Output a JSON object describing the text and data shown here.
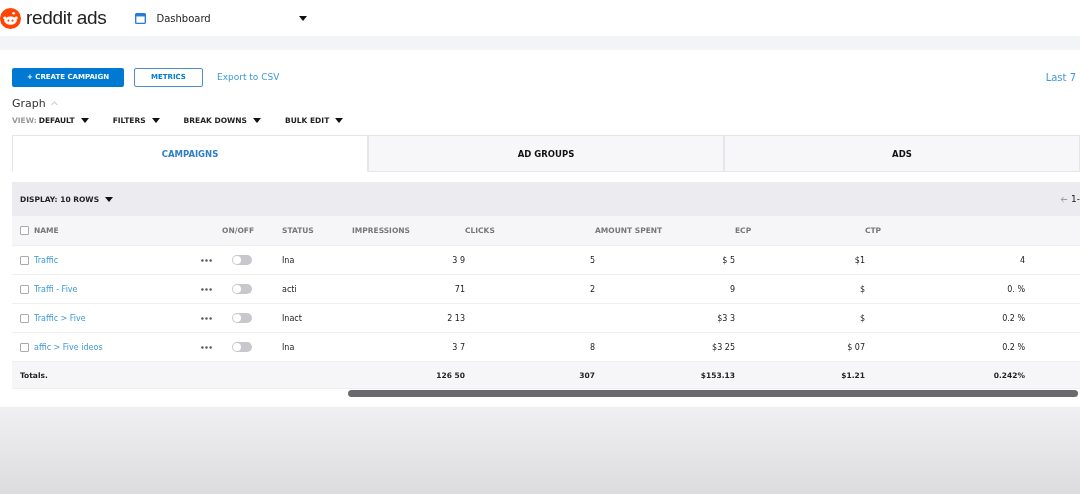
{
  "header": {
    "logo": "reddit ads",
    "page": "Dashboard"
  },
  "actions": {
    "create": "+ CREATE CAMPAIGN",
    "metrics": "METRICS",
    "export": "Export to CSV",
    "date_range": "Last 7"
  },
  "graph": {
    "title": "Graph",
    "expanded": true
  },
  "view_controls": [
    {
      "label": "VIEW:",
      "value": "DEFAULT"
    },
    {
      "label": "FILTERS"
    },
    {
      "label": "BREAK DOWNS"
    },
    {
      "label": "BULK EDIT"
    }
  ],
  "tabs": [
    {
      "label": "CAMPAIGNS",
      "selected": true
    },
    {
      "label": "AD GROUPS",
      "selected": false
    },
    {
      "label": "ADS",
      "selected": false
    }
  ],
  "table": {
    "display": "DISPLAY: 10 ROWS",
    "pagination": "1-",
    "select_all_checked": false,
    "columns": [
      "NAME",
      "ON/OFF",
      "STATUS",
      "IMPRESSIONS",
      "CLICKS",
      "AMOUNT SPENT",
      "ECP",
      "CTP"
    ],
    "rows": [
      {
        "checked": false,
        "name": "Traffic",
        "on": false,
        "status": "Ina",
        "impressions": "3 9",
        "clicks": "5",
        "spent": "$ 5",
        "ecpm": "$1",
        "ctr": "4"
      },
      {
        "checked": false,
        "name": "Traffi - Five",
        "on": false,
        "status": "acti",
        "impressions": "71",
        "clicks": "2",
        "spent": "9",
        "ecpm": "$",
        "ctr": "0. %"
      },
      {
        "checked": false,
        "name": "Traffic > Five",
        "on": false,
        "status": "Inact",
        "impressions": "2 13",
        "spent": "$3 3",
        "ecpm": "$",
        "ctr": "0.2 %"
      },
      {
        "checked": false,
        "name": "affic > Five ideos",
        "on": false,
        "status": "Ina",
        "impressions": "3 7",
        "clicks": "8",
        "spent": "$3 25",
        "ecpm": "$ 07",
        "ctr": "0.2 %"
      }
    ],
    "totals": {
      "label": "Totals.",
      "impressions": "126 50",
      "clicks": "307",
      "spent": "$153.13",
      "ecpm": "$1.21",
      "ctr": "0.242%"
    }
  }
}
